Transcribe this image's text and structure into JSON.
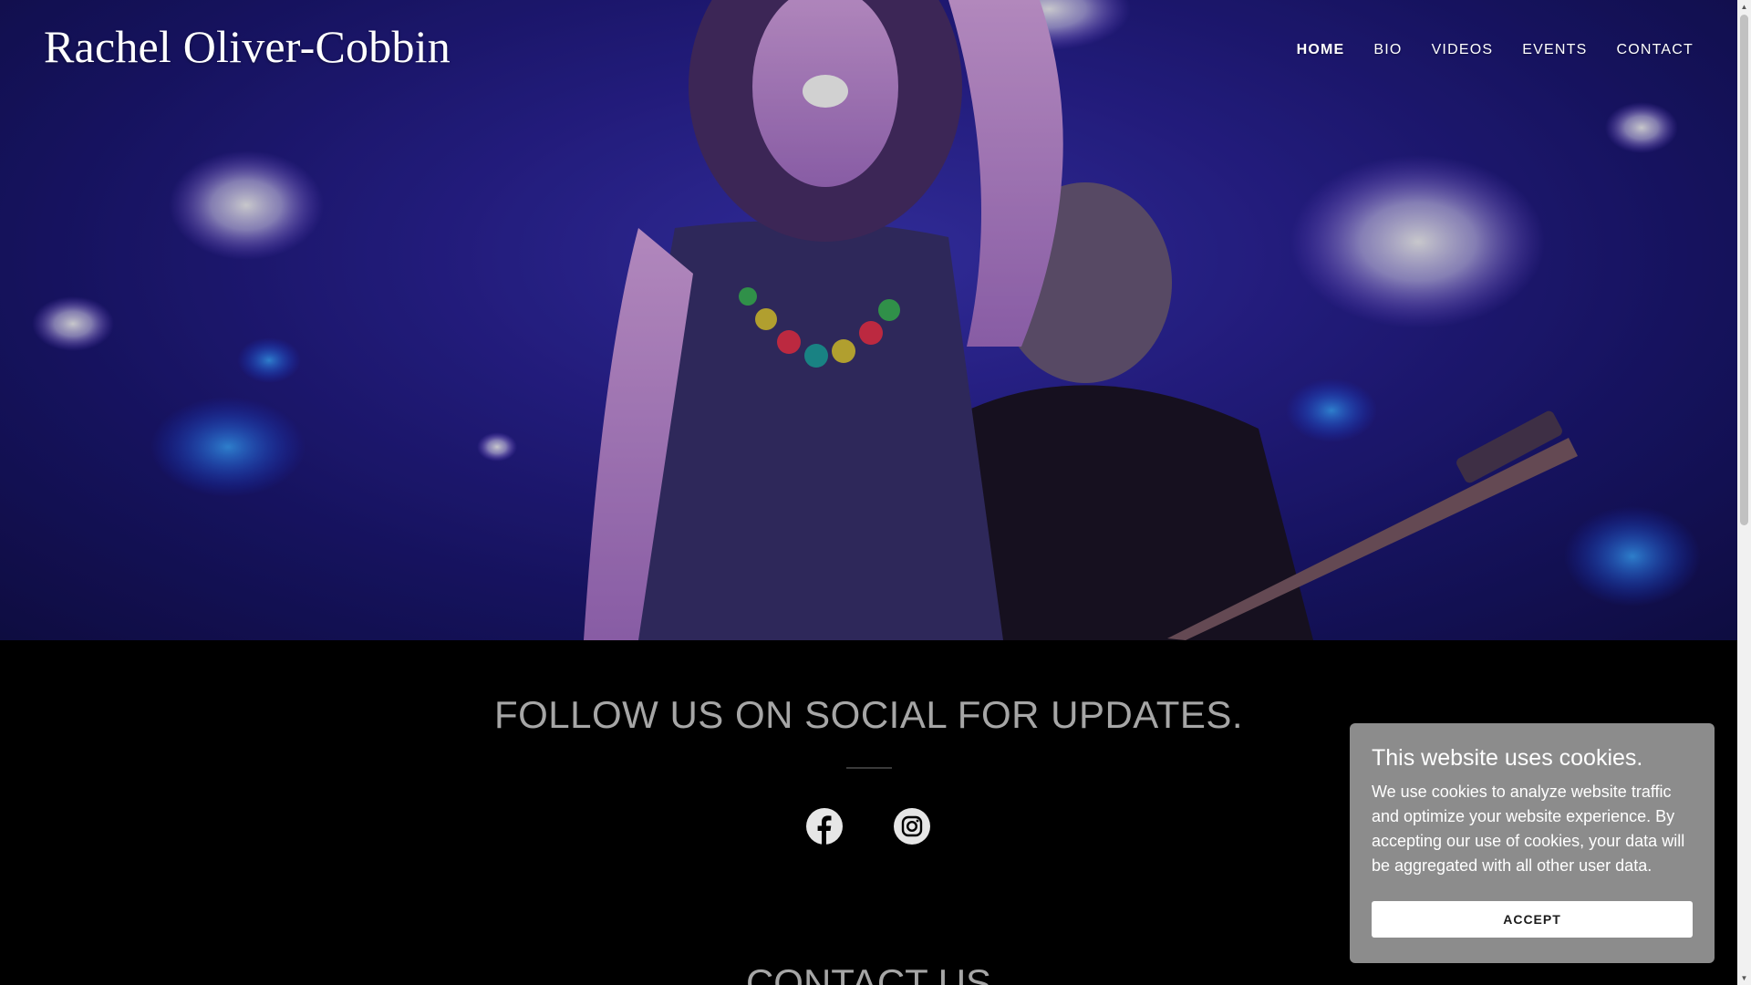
{
  "header": {
    "site_title": "Rachel Oliver-Cobbin",
    "nav": [
      {
        "label": "HOME",
        "active": true
      },
      {
        "label": "BIO",
        "active": false
      },
      {
        "label": "VIDEOS",
        "active": false
      },
      {
        "label": "EVENTS",
        "active": false
      },
      {
        "label": "CONTACT",
        "active": false
      }
    ]
  },
  "hero": {
    "image": "photo of a singer performing on stage with arm raised and a guitarist, purple-blue stage lighting"
  },
  "follow": {
    "heading": "FOLLOW US ON SOCIAL FOR UPDATES.",
    "icons": [
      "facebook-icon",
      "instagram-icon"
    ]
  },
  "contact": {
    "heading": "CONTACT US"
  },
  "cookie_banner": {
    "title": "This website uses cookies.",
    "text": "We use cookies to analyze website traffic and optimize your website experience. By accepting our use of cookies, your data will be aggregated with all other user data.",
    "accept_label": "ACCEPT"
  },
  "colors": {
    "page_background": "#000000",
    "heading_gray": "#a6a6a6",
    "cookie_background": "#8c8c8c",
    "stage_blue": "#2a2296"
  }
}
